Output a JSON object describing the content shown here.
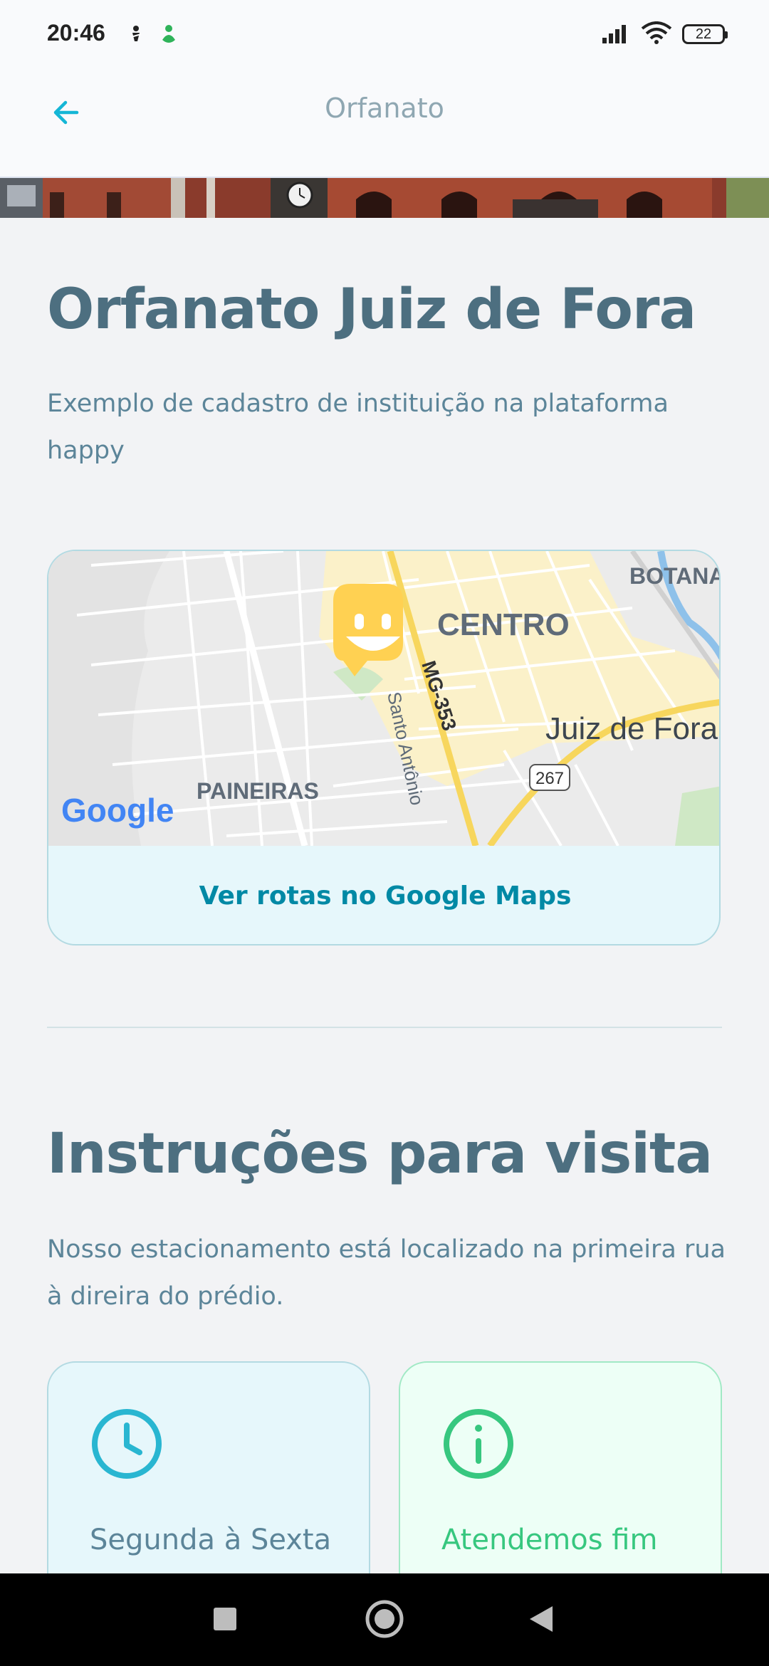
{
  "status_bar": {
    "time": "20:46",
    "battery": "22"
  },
  "header": {
    "title": "Orfanato"
  },
  "orphanage": {
    "name": "Orfanato Juiz de Fora",
    "description": "Exemplo de cadastro de instituição na plataforma happy"
  },
  "map": {
    "labels": {
      "botanica": "BOTANA",
      "centro": "CENTRO",
      "route": "MG-353",
      "street": "Santo Antônio",
      "city": "Juiz de Fora",
      "paineiras": "PAINEIRAS",
      "highway": "267",
      "google": "Google"
    },
    "link_label": "Ver rotas no Google Maps"
  },
  "visit": {
    "section_title": "Instruções para visita",
    "instructions": "Nosso estacionamento está localizado na primeira rua à direira do prédio.",
    "opening_hours": "Segunda à Sexta",
    "weekends": "Atendemos fim"
  },
  "colors": {
    "background": "#f2f3f5",
    "title": "#4d6f80",
    "link": "#0089a5",
    "hours_icon": "#29b6d1",
    "weekend_icon": "#37c77f",
    "marker": "#ffd152"
  },
  "icons": {
    "back": "arrow-left-icon",
    "clock": "clock-icon",
    "info": "info-icon",
    "marker": "smiley-map-marker-icon"
  }
}
